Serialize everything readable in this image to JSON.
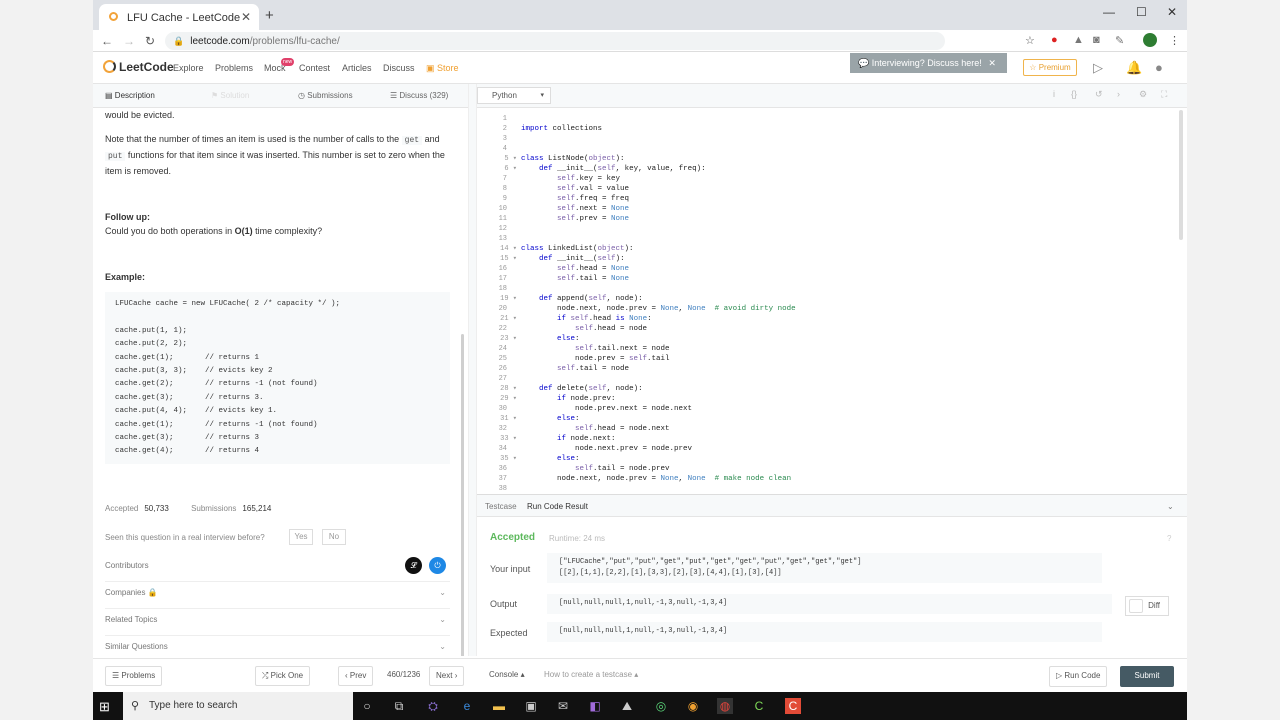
{
  "browser": {
    "tab_title": "LFU Cache - LeetCode",
    "url_host": "leetcode.com",
    "url_path": "/problems/lfu-cache/"
  },
  "nav": {
    "logo_text": "LeetCode",
    "links": [
      "Explore",
      "Problems",
      "Mock",
      "Contest",
      "Articles",
      "Discuss",
      "Store"
    ],
    "new_badge": "new",
    "interviewing_banner": "Interviewing? Discuss here!",
    "premium": "Premium"
  },
  "left_tabs": {
    "description": "Description",
    "solution": "Solution",
    "submissions": "Submissions",
    "discuss": "Discuss (329)"
  },
  "description": {
    "evicted_tail": "would be evicted.",
    "note_prefix": "Note that the number of times an item is used is the number of calls to the",
    "note_get": "get",
    "note_and": "and",
    "note_put": "put",
    "note_suffix": "functions for that item since it was inserted. This number is set to zero when the item is removed.",
    "followup_title": "Follow up:",
    "followup_prefix": "Could you do both operations in",
    "followup_bold": "O(1)",
    "followup_suffix": "time complexity?",
    "example_title": "Example:",
    "example_lines": [
      "LFUCache cache = new LFUCache( 2 /* capacity */ );",
      "",
      "cache.put(1, 1);",
      "cache.put(2, 2);",
      "cache.get(1);       // returns 1",
      "cache.put(3, 3);    // evicts key 2",
      "cache.get(2);       // returns -1 (not found)",
      "cache.get(3);       // returns 3.",
      "cache.put(4, 4);    // evicts key 1.",
      "cache.get(1);       // returns -1 (not found)",
      "cache.get(3);       // returns 3",
      "cache.get(4);       // returns 4"
    ]
  },
  "stats": {
    "accepted_label": "Accepted",
    "accepted_value": "50,733",
    "submissions_label": "Submissions",
    "submissions_value": "165,214"
  },
  "seen": {
    "question": "Seen this question in a real interview before?",
    "yes": "Yes",
    "no": "No"
  },
  "meta_rows": {
    "contributors": "Contributors",
    "companies": "Companies",
    "related": "Related Topics",
    "similar": "Similar Questions"
  },
  "editor": {
    "language": "Python",
    "line_numbers": [
      "1",
      "2",
      "3",
      "4",
      "5",
      "6",
      "7",
      "8",
      "9",
      "10",
      "11",
      "12",
      "13",
      "14",
      "15",
      "16",
      "17",
      "18",
      "19",
      "20",
      "21",
      "22",
      "23",
      "24",
      "25",
      "26",
      "27",
      "28",
      "29",
      "30",
      "31",
      "32",
      "33",
      "34",
      "35",
      "36",
      "37",
      "38"
    ],
    "code_lines": [
      "",
      "import collections",
      "",
      "",
      "class ListNode(object):",
      "    def __init__(self, key, value, freq):",
      "        self.key = key",
      "        self.val = value",
      "        self.freq = freq",
      "        self.next = None",
      "        self.prev = None",
      "",
      "",
      "class LinkedList(object):",
      "    def __init__(self):",
      "        self.head = None",
      "        self.tail = None",
      "",
      "    def append(self, node):",
      "        node.next, node.prev = None, None  # avoid dirty node",
      "        if self.head is None:",
      "            self.head = node",
      "        else:",
      "            self.tail.next = node",
      "            node.prev = self.tail",
      "        self.tail = node",
      "",
      "    def delete(self, node):",
      "        if node.prev:",
      "            node.prev.next = node.next",
      "        else:",
      "            self.head = node.next",
      "        if node.next:",
      "            node.next.prev = node.prev",
      "        else:",
      "            self.tail = node.prev",
      "        node.next, node.prev = None, None  # make node clean",
      ""
    ]
  },
  "result_panel": {
    "tab_testcase": "Testcase",
    "tab_run_result": "Run Code Result",
    "status": "Accepted",
    "runtime": "Runtime: 24 ms",
    "your_input_label": "Your input",
    "your_input_line1": "[\"LFUCache\",\"put\",\"put\",\"get\",\"put\",\"get\",\"get\",\"put\",\"get\",\"get\",\"get\"]",
    "your_input_line2": "[[2],[1,1],[2,2],[1],[3,3],[2],[3],[4,4],[1],[3],[4]]",
    "output_label": "Output",
    "output_value": "[null,null,null,1,null,-1,3,null,-1,3,4]",
    "diff": "Diff",
    "expected_label": "Expected",
    "expected_value": "[null,null,null,1,null,-1,3,null,-1,3,4]"
  },
  "bottom_bar": {
    "problems": "Problems",
    "pick_one": "Pick One",
    "prev": "Prev",
    "page": "460/1236",
    "next": "Next",
    "console": "Console",
    "how_to": "How to create a testcase",
    "run_code": "Run Code",
    "submit": "Submit"
  },
  "taskbar": {
    "search_placeholder": "Type here to search"
  },
  "colors": {
    "accepted_green": "#5cb85c",
    "submit_bg": "#455a64",
    "store_orange": "#f0a030"
  }
}
